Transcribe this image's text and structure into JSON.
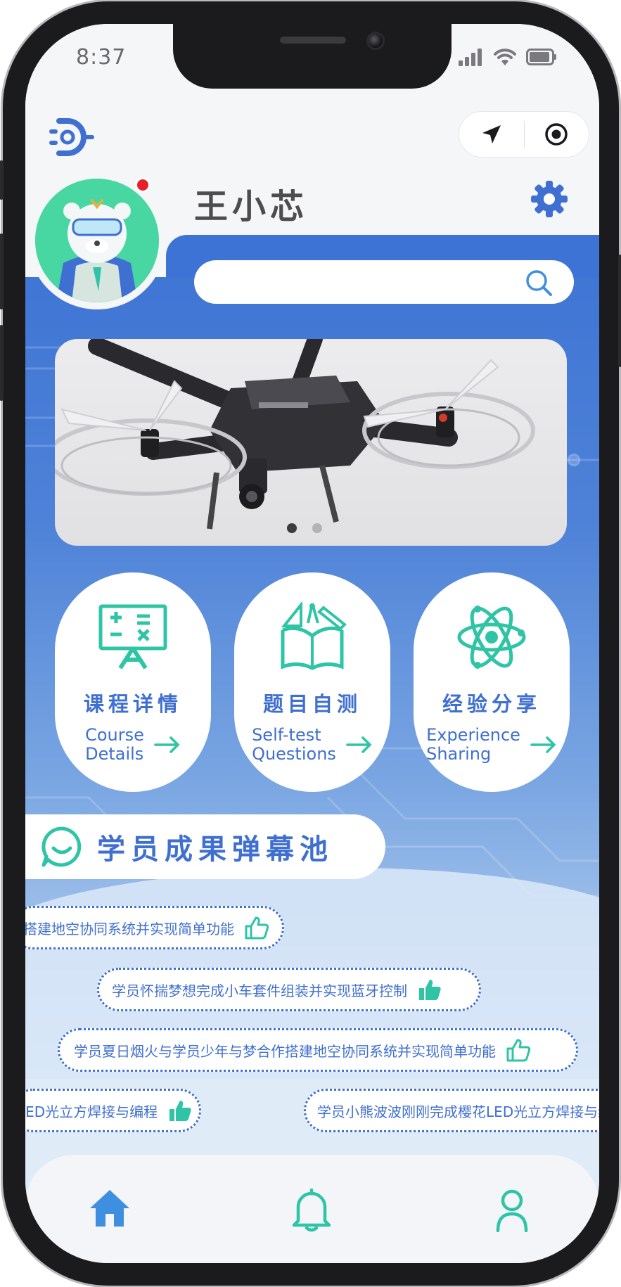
{
  "status_bar": {
    "time": "8:37"
  },
  "header": {
    "user_name": "王小芯",
    "search": {
      "placeholder": ""
    }
  },
  "banner": {
    "slide_count": 2,
    "active_slide": 1
  },
  "cards": [
    {
      "cn": "课程详情",
      "en_line1": "Course",
      "en_line2": "Details",
      "icon": "blackboard-icon"
    },
    {
      "cn": "题目自测",
      "en_line1": "Self-test",
      "en_line2": "Questions",
      "icon": "book-ruler-icon"
    },
    {
      "cn": "经验分享",
      "en_line1": "Experience",
      "en_line2": "Sharing",
      "icon": "atom-icon"
    }
  ],
  "danmu": {
    "title": "学员成果弹幕池",
    "items": [
      {
        "text": "搭建地空协同系统并实现简单功能",
        "liked": false
      },
      {
        "text": "学员怀揣梦想完成小车套件组装并实现蓝牙控制",
        "liked": true
      },
      {
        "text": "学员夏日烟火与学员少年与梦合作搭建地空协同系统并实现简单功能",
        "liked": false
      },
      {
        "text": "LED光立方焊接与编程",
        "liked": true
      },
      {
        "text": "学员小熊波波刚刚完成樱花LED光立方焊接与编程",
        "liked": false
      }
    ]
  },
  "colors": {
    "primary": "#3f6fd1",
    "accent": "#2ec4a5",
    "badge": "#e8202a"
  },
  "bottom_nav": [
    "home-icon",
    "bell-icon",
    "user-icon"
  ]
}
